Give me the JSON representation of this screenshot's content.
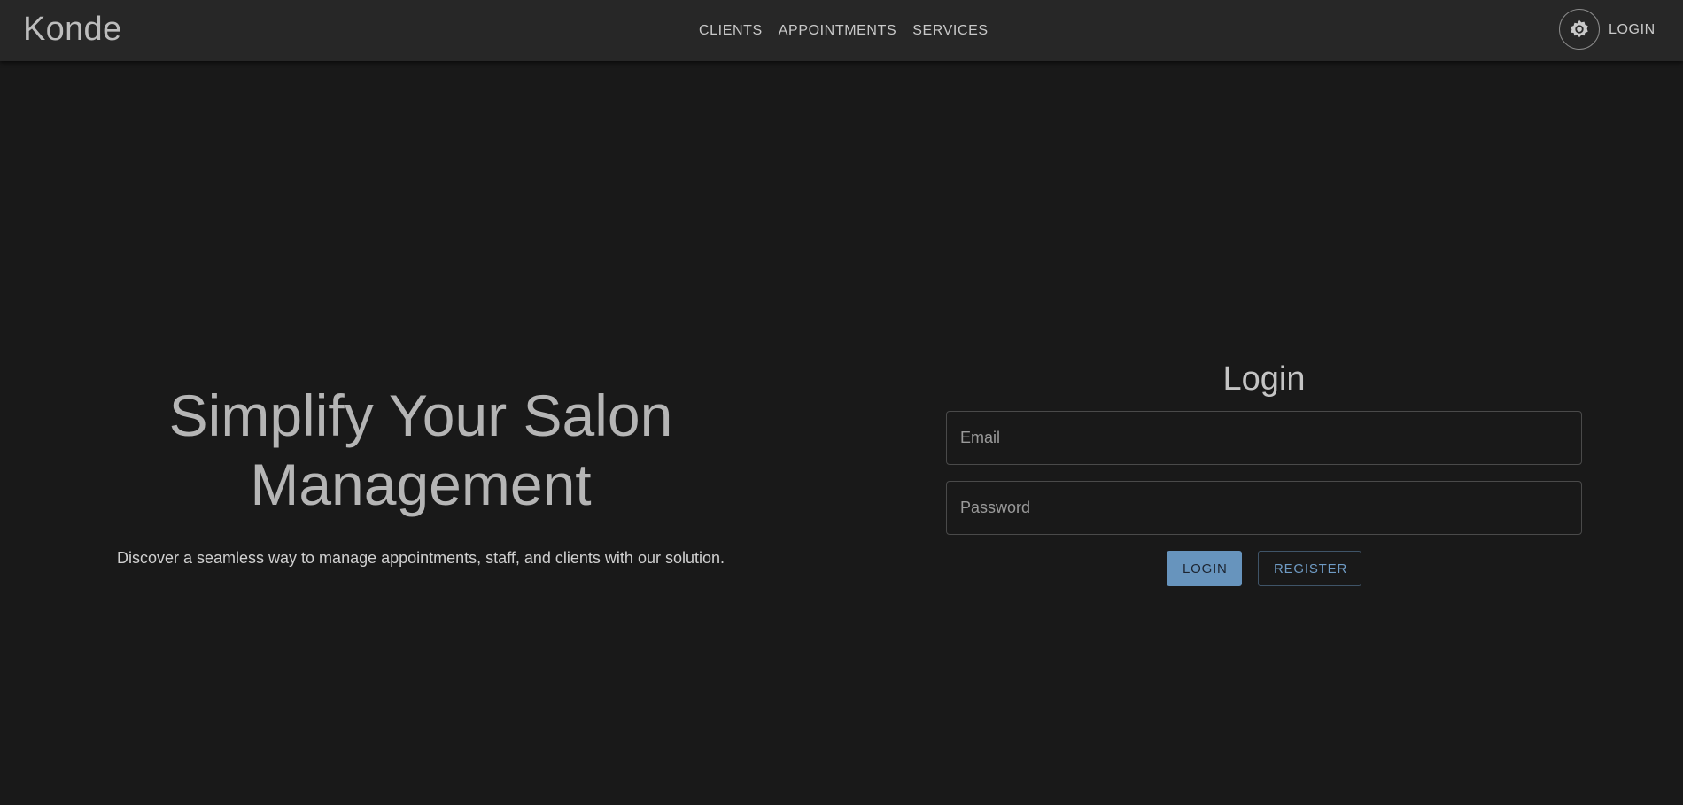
{
  "header": {
    "brand": "Konde",
    "nav": [
      "CLIENTS",
      "APPOINTMENTS",
      "SERVICES"
    ],
    "theme_toggle_icon": "gear-icon",
    "login_label": "LOGIN"
  },
  "hero": {
    "title": "Simplify Your Salon Management",
    "subtitle": "Discover a seamless way to manage appointments, staff, and clients with our solution."
  },
  "login_form": {
    "title": "Login",
    "email_placeholder": "Email",
    "email_value": "",
    "password_placeholder": "Password",
    "password_value": "",
    "login_button": "LOGIN",
    "register_button": "REGISTER"
  },
  "colors": {
    "background": "#191919",
    "header": "#272727",
    "accent": "#6794bd"
  }
}
